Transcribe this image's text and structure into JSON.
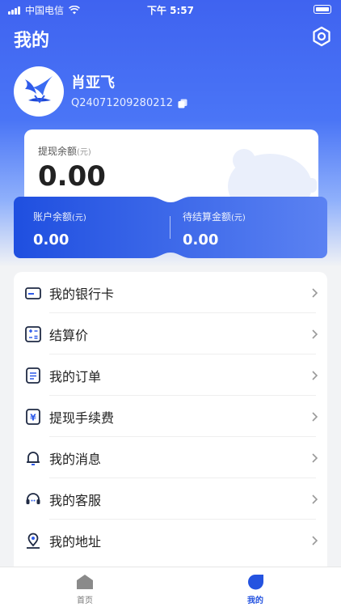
{
  "status_bar": {
    "carrier": "中国电信",
    "time": "下午 5:57"
  },
  "header": {
    "title": "我的"
  },
  "user": {
    "name": "肖亚飞",
    "id": "Q24071209280212"
  },
  "balance": {
    "label": "提现余额",
    "unit": "(元)",
    "value": "0.00"
  },
  "accounts": [
    {
      "label": "账户余额",
      "unit": "(元)",
      "value": "0.00"
    },
    {
      "label": "待结算金额",
      "unit": "(元)",
      "value": "0.00"
    }
  ],
  "menu": [
    {
      "label": "我的银行卡",
      "icon": "bank-card-icon"
    },
    {
      "label": "结算价",
      "icon": "calculator-icon"
    },
    {
      "label": "我的订单",
      "icon": "order-icon"
    },
    {
      "label": "提现手续费",
      "icon": "withdraw-fee-icon"
    },
    {
      "label": "我的消息",
      "icon": "bell-icon"
    },
    {
      "label": "我的客服",
      "icon": "customer-service-icon"
    },
    {
      "label": "我的地址",
      "icon": "location-icon"
    }
  ],
  "tabs": [
    {
      "label": "首页",
      "icon": "home-icon",
      "active": false
    },
    {
      "label": "我的",
      "icon": "profile-icon",
      "active": true
    }
  ],
  "colors": {
    "primary": "#2f5bea",
    "active_tab": "#2453e0",
    "inactive_tab": "#777777"
  }
}
